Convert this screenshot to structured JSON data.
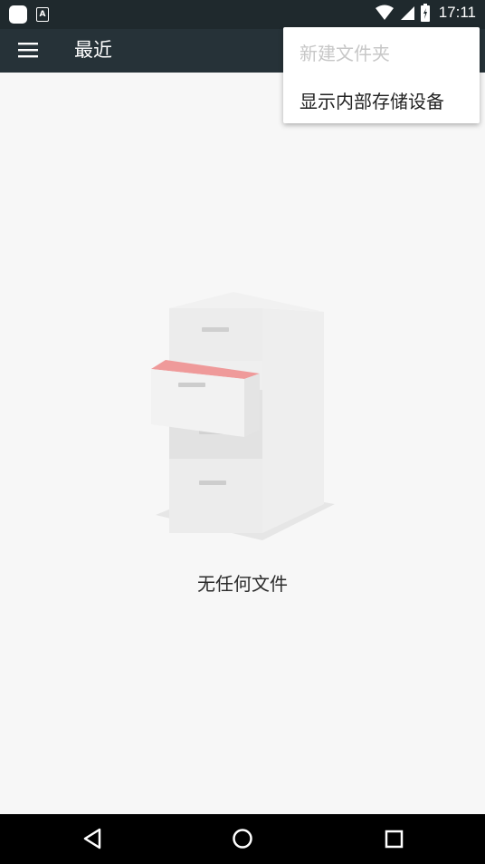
{
  "status_bar": {
    "time": "17:11",
    "icons": [
      "notification-square-icon",
      "a-letter-icon",
      "wifi-icon",
      "signal-icon",
      "battery-icon"
    ]
  },
  "app_bar": {
    "title": "最近",
    "menu_icon": "hamburger-menu-icon",
    "background": "#263238"
  },
  "overflow_menu": {
    "items": [
      {
        "label": "新建文件夹",
        "enabled": false
      },
      {
        "label": "显示内部存储设备",
        "enabled": true
      }
    ]
  },
  "empty_state": {
    "icon": "file-cabinet-illustration",
    "message": "无任何文件"
  },
  "nav_bar": {
    "buttons": [
      "back-icon",
      "home-icon",
      "recents-icon"
    ]
  }
}
